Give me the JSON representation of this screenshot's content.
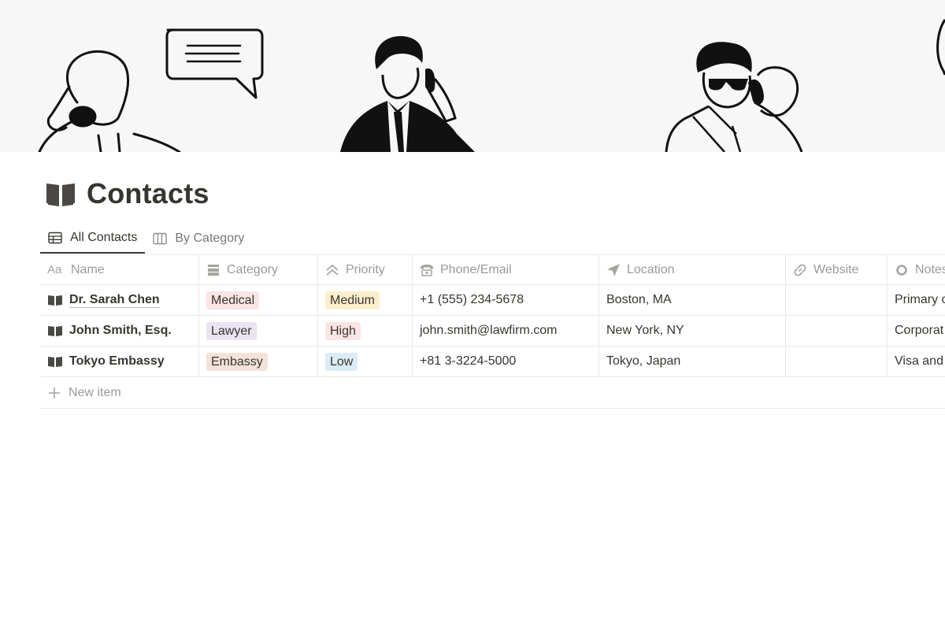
{
  "cover": {
    "icons": [
      "person-phone-speech-bubble-illustration",
      "businessman-phone-illustration",
      "sunglasses-man-phone-illustration"
    ]
  },
  "page": {
    "title": "Contacts",
    "icon": "open-book-icon"
  },
  "tabs": [
    {
      "label": "All Contacts",
      "icon": "table-icon",
      "active": true
    },
    {
      "label": "By Category",
      "icon": "board-icon",
      "active": false
    }
  ],
  "table": {
    "columns": [
      {
        "label": "Name",
        "icon": "text-aa-icon"
      },
      {
        "label": "Category",
        "icon": "select-icon"
      },
      {
        "label": "Priority",
        "icon": "chevrons-up-icon"
      },
      {
        "label": "Phone/Email",
        "icon": "phone-icon"
      },
      {
        "label": "Location",
        "icon": "location-arrow-icon"
      },
      {
        "label": "Website",
        "icon": "link-icon"
      },
      {
        "label": "Notes",
        "icon": "circle-icon"
      }
    ],
    "rows": [
      {
        "name": "Dr. Sarah Chen",
        "category": "Medical",
        "priority": "Medium",
        "contact": "+1 (555) 234-5678",
        "location": "Boston, MA",
        "website": "",
        "notes": "Primary c"
      },
      {
        "name": "John Smith, Esq.",
        "category": "Lawyer",
        "priority": "High",
        "contact": "john.smith@lawfirm.com",
        "location": "New York, NY",
        "website": "",
        "notes": "Corporat"
      },
      {
        "name": "Tokyo Embassy",
        "category": "Embassy",
        "priority": "Low",
        "contact": "+81 3-3224-5000",
        "location": "Tokyo, Japan",
        "website": "",
        "notes": "Visa and"
      }
    ],
    "new_item_label": "New item"
  },
  "colors": {
    "medical": "#fbe4e4",
    "lawyer": "#eae4f2",
    "embassy": "#f4e2da",
    "priority_medium": "#fbeecc",
    "priority_high": "#fbe4e4",
    "priority_low": "#dbecf5"
  }
}
